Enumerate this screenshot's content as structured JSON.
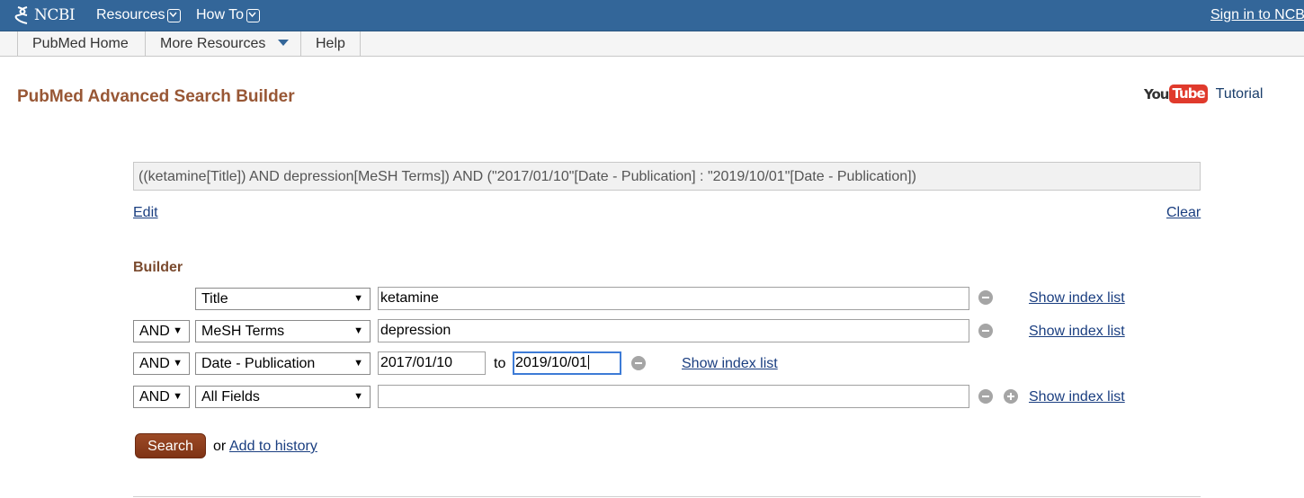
{
  "topbar": {
    "logo_text": "NCBI",
    "menus": [
      {
        "label": "Resources"
      },
      {
        "label": "How To"
      }
    ],
    "signin": "Sign in to NCBI"
  },
  "navbar": {
    "items": [
      {
        "label": "PubMed Home"
      },
      {
        "label": "More Resources"
      },
      {
        "label": "Help"
      }
    ]
  },
  "page": {
    "title": "PubMed Advanced Search Builder",
    "youtube": {
      "you": "You",
      "tube": "Tube",
      "tutorial": "Tutorial"
    }
  },
  "query": {
    "text": "((ketamine[Title]) AND depression[MeSH Terms]) AND (\"2017/01/10\"[Date - Publication] : \"2019/10/01\"[Date - Publication])",
    "edit": "Edit",
    "clear": "Clear"
  },
  "builder": {
    "label": "Builder",
    "rows": [
      {
        "field": "Title",
        "value": "ketamine",
        "index": "Show index list"
      },
      {
        "op": "AND",
        "field": "MeSH Terms",
        "value": "depression",
        "index": "Show index list"
      },
      {
        "op": "AND",
        "field": "Date - Publication",
        "from": "2017/01/10",
        "to_label": "to",
        "to": "2019/10/01",
        "index": "Show index list"
      },
      {
        "op": "AND",
        "field": "All Fields",
        "value": "",
        "index": "Show index list"
      }
    ]
  },
  "actions": {
    "search": "Search",
    "or": "or",
    "add_history": "Add to history"
  },
  "colors": {
    "topbar": "#336699",
    "title": "#985735",
    "search_button": "#8a3a1e"
  }
}
